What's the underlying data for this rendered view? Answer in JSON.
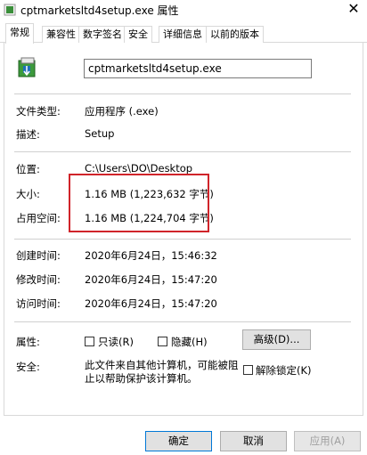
{
  "window": {
    "title": "cptmarketsltd4setup.exe 属性",
    "close_glyph": "✕"
  },
  "tabs": [
    {
      "label": "常规",
      "active": true
    },
    {
      "label": "兼容性"
    },
    {
      "label": "数字签名"
    },
    {
      "label": "安全"
    },
    {
      "label": "详细信息"
    },
    {
      "label": "以前的版本"
    }
  ],
  "general": {
    "file_name": "cptmarketsltd4setup.exe",
    "file_type_label": "文件类型:",
    "file_type_value": "应用程序 (.exe)",
    "description_label": "描述:",
    "description_value": "Setup",
    "location_label": "位置:",
    "location_value": "C:\\Users\\DO\\Desktop",
    "size_label": "大小:",
    "size_value": "1.16 MB (1,223,632 字节)",
    "size_on_disk_label": "占用空间:",
    "size_on_disk_value": "1.16 MB (1,224,704 字节)",
    "created_label": "创建时间:",
    "created_value": "2020年6月24日，15:46:32",
    "modified_label": "修改时间:",
    "modified_value": "2020年6月24日，15:47:20",
    "accessed_label": "访问时间:",
    "accessed_value": "2020年6月24日，15:47:20",
    "attributes_label": "属性:",
    "readonly_label": "只读(R)",
    "hidden_label": "隐藏(H)",
    "advanced_button": "高级(D)...",
    "security_label": "安全:",
    "security_text": "此文件来自其他计算机，可能被阻止以帮助保护该计算机。",
    "unblock_label": "解除锁定(K)"
  },
  "footer": {
    "ok": "确定",
    "cancel": "取消",
    "apply": "应用(A)"
  },
  "colors": {
    "highlight": "#d0242a",
    "primary_border": "#0078d7"
  }
}
